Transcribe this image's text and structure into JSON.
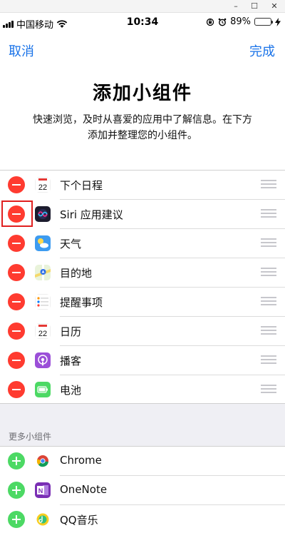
{
  "window": {
    "minimize": "–",
    "maximize": "☐",
    "close": "✕"
  },
  "status": {
    "carrier": "中国移动",
    "time": "10:34",
    "battery": "89%",
    "battery_level": 0.89,
    "battery_color": "#4cd964"
  },
  "nav": {
    "cancel": "取消",
    "done": "完成",
    "accent": "#1a73e8"
  },
  "header": {
    "title": "添加小组件",
    "desc_line1": "快速浏览，及时从喜爱的应用中了解信息。在下方",
    "desc_line2": "添加并整理您的小组件。"
  },
  "enabled_widgets": [
    {
      "label": "下个日程",
      "icon": "calendar-icon",
      "badge": "22"
    },
    {
      "label": "Siri 应用建议",
      "icon": "siri-icon"
    },
    {
      "label": "天气",
      "icon": "weather-icon"
    },
    {
      "label": "目的地",
      "icon": "maps-icon"
    },
    {
      "label": "提醒事项",
      "icon": "reminders-icon"
    },
    {
      "label": "日历",
      "icon": "calendar-icon",
      "badge": "22"
    },
    {
      "label": "播客",
      "icon": "podcasts-icon"
    },
    {
      "label": "电池",
      "icon": "battery-icon"
    }
  ],
  "more": {
    "title": "更多小组件",
    "items": [
      {
        "label": "Chrome",
        "icon": "chrome-icon"
      },
      {
        "label": "OneNote",
        "icon": "onenote-icon",
        "badge": "N"
      },
      {
        "label": "QQ音乐",
        "icon": "qqmusic-icon"
      }
    ]
  }
}
